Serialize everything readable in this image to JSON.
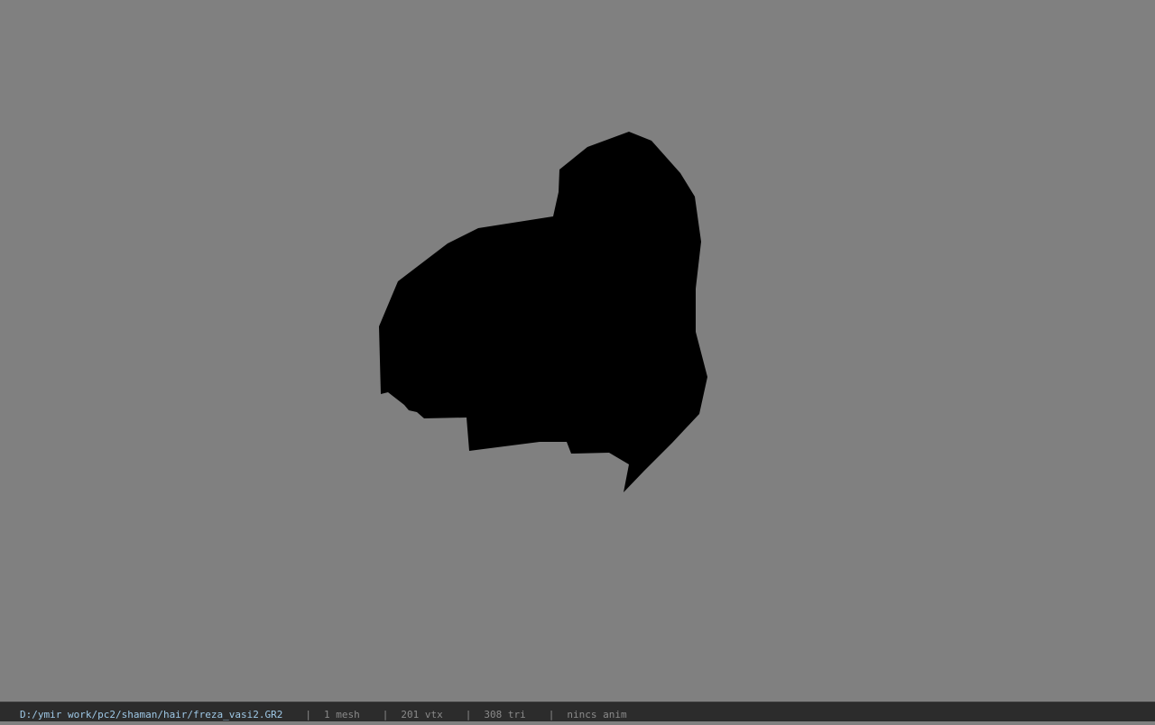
{
  "viewer": {
    "background_color": "#808080",
    "model_color": "#000000"
  },
  "status": {
    "file_path": "D:/ymir work/pc2/shaman/hair/freza_vasi2.GR2",
    "separator": "|",
    "mesh_count": "1 mesh",
    "vertex_count": "201 vtx",
    "triangle_count": "308 tri",
    "anim_status": "nincs anim"
  }
}
